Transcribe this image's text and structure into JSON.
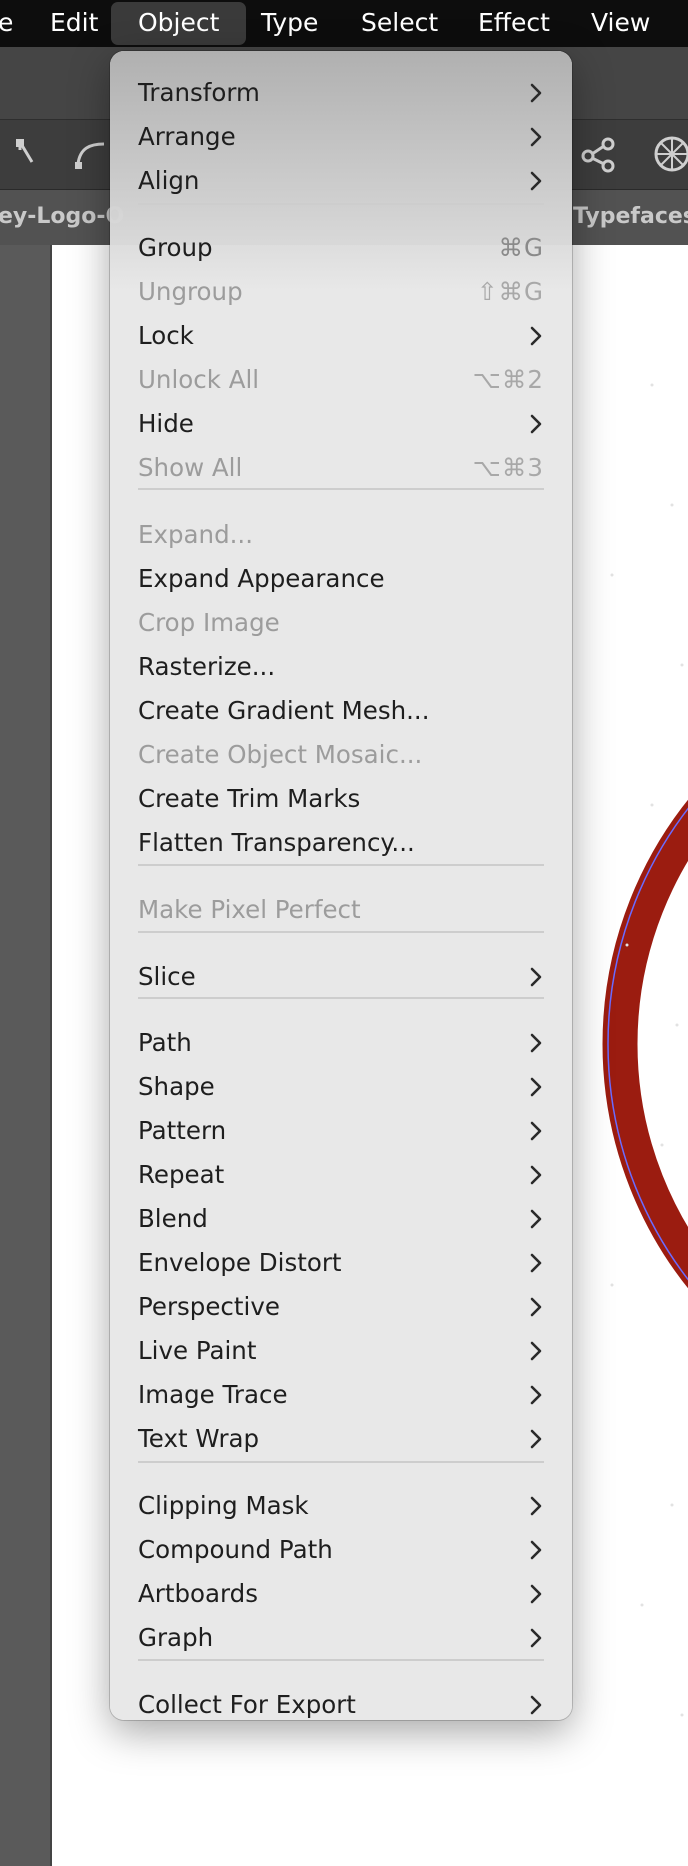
{
  "menubar": {
    "items": [
      "e",
      "Edit",
      "Object",
      "Type",
      "Select",
      "Effect",
      "View"
    ],
    "active": "Object"
  },
  "tabs": {
    "left": "ey-Logo-O",
    "right": "Typefaces.a"
  },
  "colors": {
    "ring": "#9b1c10",
    "ring_path": "#6b6bff",
    "menu_bg": "#e7e7e7",
    "disabled_text": "#9c9c9c"
  },
  "menu": {
    "items": [
      {
        "label": "Transform",
        "submenu": true
      },
      {
        "label": "Arrange",
        "submenu": true
      },
      {
        "label": "Align",
        "submenu": true
      },
      {
        "label": "Group",
        "shortcut": "⌘G"
      },
      {
        "label": "Ungroup",
        "shortcut": "⇧⌘G",
        "disabled": true
      },
      {
        "label": "Lock",
        "submenu": true
      },
      {
        "label": "Unlock All",
        "shortcut": "⌥⌘2",
        "disabled": true
      },
      {
        "label": "Hide",
        "submenu": true
      },
      {
        "label": "Show All",
        "shortcut": "⌥⌘3",
        "disabled": true
      },
      {
        "label": "Expand...",
        "disabled": true
      },
      {
        "label": "Expand Appearance"
      },
      {
        "label": "Crop Image",
        "disabled": true
      },
      {
        "label": "Rasterize..."
      },
      {
        "label": "Create Gradient Mesh..."
      },
      {
        "label": "Create Object Mosaic...",
        "disabled": true
      },
      {
        "label": "Create Trim Marks"
      },
      {
        "label": "Flatten Transparency..."
      },
      {
        "label": "Make Pixel Perfect",
        "disabled": true
      },
      {
        "label": "Slice",
        "submenu": true
      },
      {
        "label": "Path",
        "submenu": true
      },
      {
        "label": "Shape",
        "submenu": true
      },
      {
        "label": "Pattern",
        "submenu": true
      },
      {
        "label": "Repeat",
        "submenu": true
      },
      {
        "label": "Blend",
        "submenu": true
      },
      {
        "label": "Envelope Distort",
        "submenu": true
      },
      {
        "label": "Perspective",
        "submenu": true
      },
      {
        "label": "Live Paint",
        "submenu": true
      },
      {
        "label": "Image Trace",
        "submenu": true
      },
      {
        "label": "Text Wrap",
        "submenu": true
      },
      {
        "label": "Clipping Mask",
        "submenu": true
      },
      {
        "label": "Compound Path",
        "submenu": true
      },
      {
        "label": "Artboards",
        "submenu": true
      },
      {
        "label": "Graph",
        "submenu": true
      },
      {
        "label": "Collect For Export",
        "submenu": true
      }
    ]
  }
}
